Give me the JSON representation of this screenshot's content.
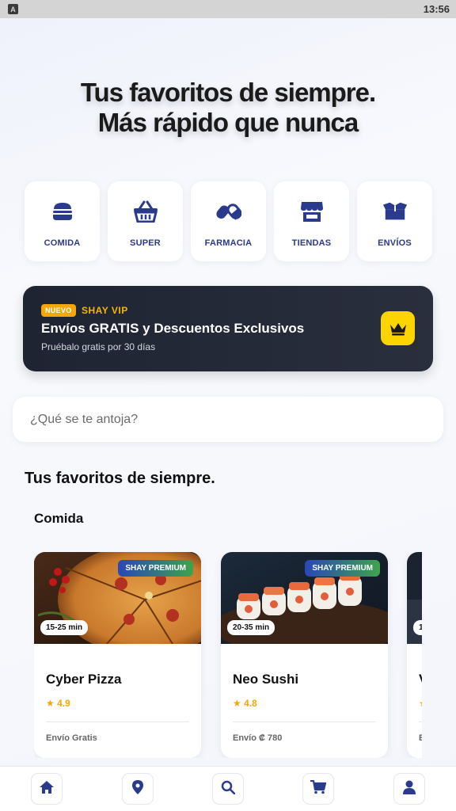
{
  "status_bar": {
    "time": "13:56",
    "app_icon": "A"
  },
  "hero": {
    "title_line1": "Tus favoritos de siempre.",
    "title_line2": "Más rápido que nunca"
  },
  "categories": [
    {
      "label": "COMIDA",
      "icon": "burger-icon"
    },
    {
      "label": "SUPER",
      "icon": "basket-icon"
    },
    {
      "label": "FARMACIA",
      "icon": "pills-icon"
    },
    {
      "label": "TIENDAS",
      "icon": "store-icon"
    },
    {
      "label": "ENVÍOS",
      "icon": "box-icon"
    }
  ],
  "vip": {
    "badge": "NUEVO",
    "brand": "SHAY VIP",
    "title": "Envíos GRATIS y Descuentos Exclusivos",
    "subtitle": "Pruébalo gratis por 30 días",
    "icon": "crown-icon"
  },
  "search": {
    "placeholder": "¿Qué se te antoja?"
  },
  "section_title": "Tus favoritos de siempre.",
  "subsection_title": "Comida",
  "restaurants": [
    {
      "name": "Cyber Pizza",
      "badge": "SHAY PREMIUM",
      "time": "15-25 min",
      "rating": "★ 4.9",
      "delivery": "Envío Gratis"
    },
    {
      "name": "Neo Sushi",
      "badge": "SHAY PREMIUM",
      "time": "20-35 min",
      "rating": "★ 4.8",
      "delivery": "Envío ₡ 780"
    },
    {
      "name": "V",
      "badge": "",
      "time": "1",
      "rating": "★",
      "delivery": "E"
    }
  ],
  "bottom_nav": [
    {
      "icon": "home-icon"
    },
    {
      "icon": "map-pin-icon"
    },
    {
      "icon": "search-icon"
    },
    {
      "icon": "cart-icon"
    },
    {
      "icon": "user-icon"
    }
  ],
  "colors": {
    "accent": "#2a3a8c",
    "gold": "#f5a70a",
    "crown_bg": "#fcd400",
    "banner_bg": "#1f2432"
  }
}
